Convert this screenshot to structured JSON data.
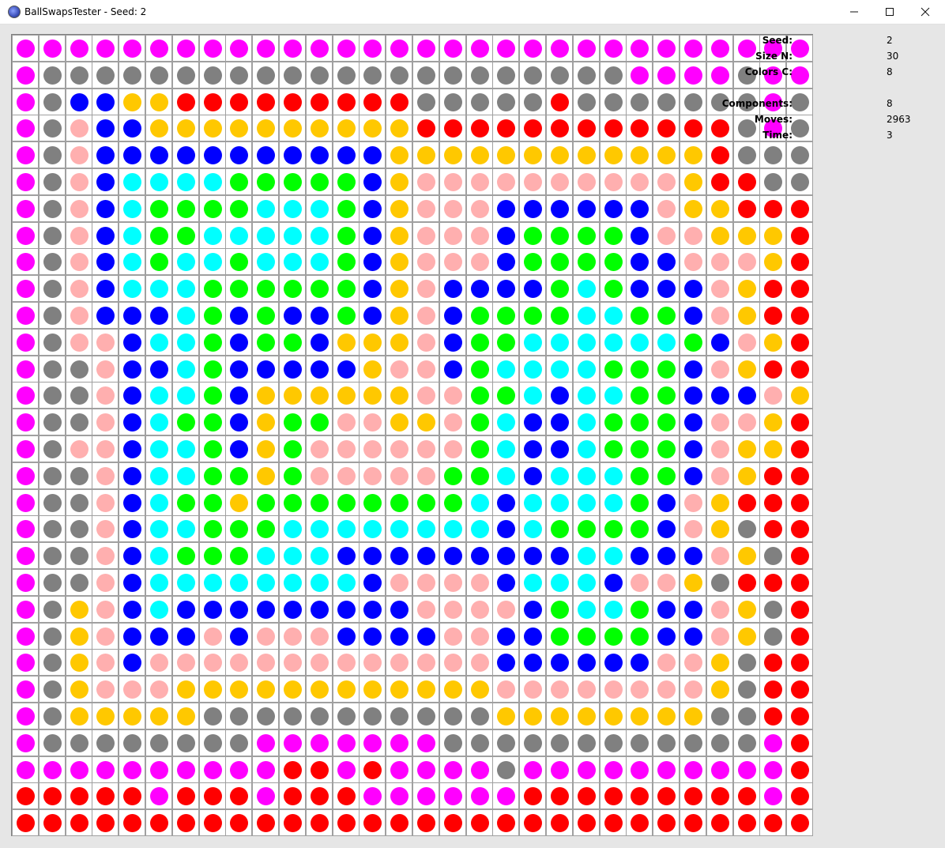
{
  "window": {
    "title": "BallSwapsTester - Seed: 2",
    "minimize_icon": "minimize-icon",
    "maximize_icon": "maximize-icon",
    "close_icon": "close-icon"
  },
  "colors": {
    "M": "#ff00ff",
    "G": "#808080",
    "B": "#0000ff",
    "Y": "#ffc800",
    "R": "#ff0000",
    "P": "#ffafaf",
    "C": "#00ffff",
    "L": "#00ff00"
  },
  "board": {
    "rows": [
      "MMMMMMMMMMMMMMMMMMMMMMMMMMMMMM",
      "MGGGGGGGGGGGGGGGGGGGGGGMMMMGMM",
      "MGBBYYRRRRRRRRRGGGGGRGGGGGGGMG",
      "MGPBBYYYYYYYYYYRRRRRRRRRRRRGMG",
      "MGPBBBBBBBBBBBYYYYYYYYYYYYRGGG",
      "MGPBCCCCLLLLLBYPPPPPPPPPPYRRGG",
      "MGPBCLLLLCCCLBYPPPBBBBBBPYYRRR",
      "MGPBCLLCCCCCLBYPPPBLLLLBPPYYYR",
      "MGPBCLCCLCCCLBYPPPBLLLLBBPPPYR",
      "MGPBCCCLLLLLLBYPBBBBLCLBBBPYR",
      "MGPBBBCLBLBBLBYPBLLLLCCLLBPYR",
      "MGPPBCCLBLLBYYYPBLLCCCCCCLBPYR",
      "MGGPBBCLBBBBBYPPBLCCCCLLLBPYR",
      "MGGPBCCLBYYYYYYPPLLCBCCLLBBBPYR",
      "MGGPBCLLBYLLPPYYPLCBBCLLLBPPYR",
      "MGPPBCCLBYLPPPPPPLCBBCLLLBPYYR",
      "MGGPBCCLLYLPPPPPLLCBCCCLLBPYRR",
      "MGGPBCLLYLLLLLLLLCBCCCCLBPYRR",
      "MGGPBCCLLLCCCCCCCCBCLLLLBPYGR",
      "MGGPBCLLLCCCBBBBBBBBBCCBBBPYGR",
      "MGGPBCCCCCCCCBPPPPBCCCBPPYGR",
      "MGYPBCBBBBBBBBBPPPPBLCCLBBPYGR",
      "MGYPBBBPBPPPBBBBPPBBLLLLBBPYGR",
      "MGYPBPPPPPPPPPPPPPBBBBBBPPYGR",
      "MGYPPPYYYYYYYYYYYYPPPPPPPPYGR",
      "MGYYYYYGGGGGGGGGGGYYYYYYYYGGR",
      "MGGGGGGGGMMMMMMMGGGGGGGGGGGGMR",
      "MMMMMMMMMMRRMRMMMMGMMMMMMMMMMR",
      "RRRRRMRRRMRRRMMMMMMRRRRRRRRRMR",
      "RRRRRRRRRRRRRRRRRRRRRRRRRRRRRR"
    ]
  },
  "stats": {
    "seed_label": "Seed:",
    "seed_value": "2",
    "size_label": "Size N:",
    "size_value": "30",
    "colors_label": "Colors C:",
    "colors_value": "8",
    "components_label": "Components:",
    "components_value": "8",
    "moves_label": "Moves:",
    "moves_value": "2963",
    "time_label": "Time:",
    "time_value": "3"
  }
}
